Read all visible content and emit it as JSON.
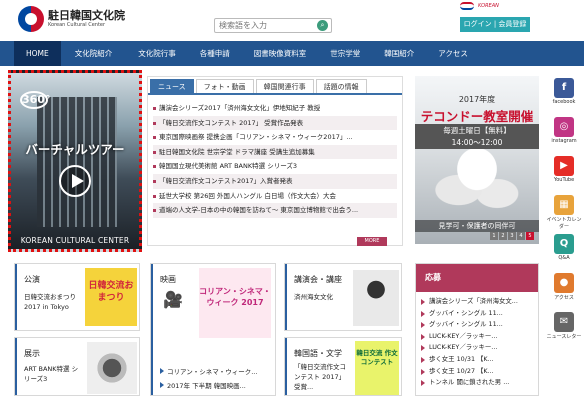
{
  "header": {
    "logo_title": "駐日韓国文化院",
    "logo_subtitle": "Korean Cultural Center",
    "search_placeholder": "検索語を入力",
    "korean_badge": "KOREAN",
    "login_label": "ログイン | 会員登録"
  },
  "nav": [
    "HOME",
    "文化院紹介",
    "文化院行事",
    "各種申請",
    "図書映像資料室",
    "世宗学堂",
    "韓国紹介",
    "アクセス"
  ],
  "hero": {
    "badge": "360°",
    "title": "バーチャルツアー",
    "caption": "KOREAN CULTURAL CENTER"
  },
  "news": {
    "tabs": [
      "ニュース",
      "フォト・動画",
      "韓国関連行事",
      "話題の情報"
    ],
    "items": [
      "講演会シリーズ2017「済州海女文化」伊地知紀子 教授",
      "「韓日交流作文コンテスト 2017」 受賞作品発表",
      "東京国際映画祭 提携企画「コリアン・シネマ・ウィーク2017」...",
      "駐日韓国文化院 世宗学堂 ドラマ講座 受講生追加募集",
      "韓国国立現代美術館 ART BANK特選 シリーズ3",
      "「韓日交流作文コンテスト2017」入賞者発表",
      "延世大学校 第26回 外国人ハングル 白日場（作文大会）大会",
      "道端の人文学-日本の中の韓国を訪ねて～ 東京国立博物館で出会う..."
    ],
    "more_label": "MORE"
  },
  "taekwondo": {
    "year": "2017年度",
    "title": "テコンドー教室開催",
    "schedule": "毎週土曜日【無料】",
    "time": "14:00～12:00",
    "subtitle": "見学可・保護者の同伴可",
    "pages": [
      "1",
      "2",
      "3",
      "4",
      "5"
    ]
  },
  "side_menu": [
    {
      "icon": "facebook-icon",
      "label": "facebook",
      "glyph": "f",
      "color": "#3b5998"
    },
    {
      "icon": "instagram-icon",
      "label": "instagram",
      "glyph": "◎",
      "color": "#c13584"
    },
    {
      "icon": "youtube-icon",
      "label": "YouTube",
      "glyph": "▶",
      "color": "#e52d27"
    },
    {
      "icon": "calendar-icon",
      "label": "イベントカレンダー",
      "glyph": "▦",
      "color": "#e8a33b"
    },
    {
      "icon": "qa-icon",
      "label": "Q&A",
      "glyph": "Q",
      "color": "#2a9d8f"
    },
    {
      "icon": "access-pin-icon",
      "label": "アクセス",
      "glyph": "●",
      "color": "#e07a2e"
    },
    {
      "icon": "newsletter-icon",
      "label": "ニュースレター",
      "glyph": "✉",
      "color": "#666666"
    }
  ],
  "cards": {
    "performance": {
      "title": "公演",
      "body": "日韓交流おまつり 2017 in Tokyo",
      "img_text": "日韓交流おまつり"
    },
    "film": {
      "title": "映画",
      "img_text": "コリアン・シネマ・ウィーク 2017",
      "links": [
        "コリアン・シネマ・ウィーク...",
        "2017年 下半期 韓国映画..."
      ]
    },
    "lecture": {
      "title": "講演会・講座",
      "body": "済州海女文化"
    },
    "exhibition": {
      "title": "展示",
      "body": "ART BANK特選 シリーズ3"
    },
    "language": {
      "title": "韓国語・文学",
      "body": "「韓日交流作文コンテスト 2017」 受賞...",
      "img_text": "韓日交流 作文 コンテスト"
    }
  },
  "ouen": {
    "title": "応募",
    "items": [
      "講演会シリーズ「済州海女文...",
      "グッバイ・シングル 11...",
      "グッバイ・シングル 11...",
      "LUCK-KEY／ラッキー...",
      "LUCK-KEY／ラッキー...",
      "歩く女王 10/31 【K...",
      "歩く女王 10/27 【K...",
      "トンネル 闇に鎖された男 ..."
    ]
  }
}
